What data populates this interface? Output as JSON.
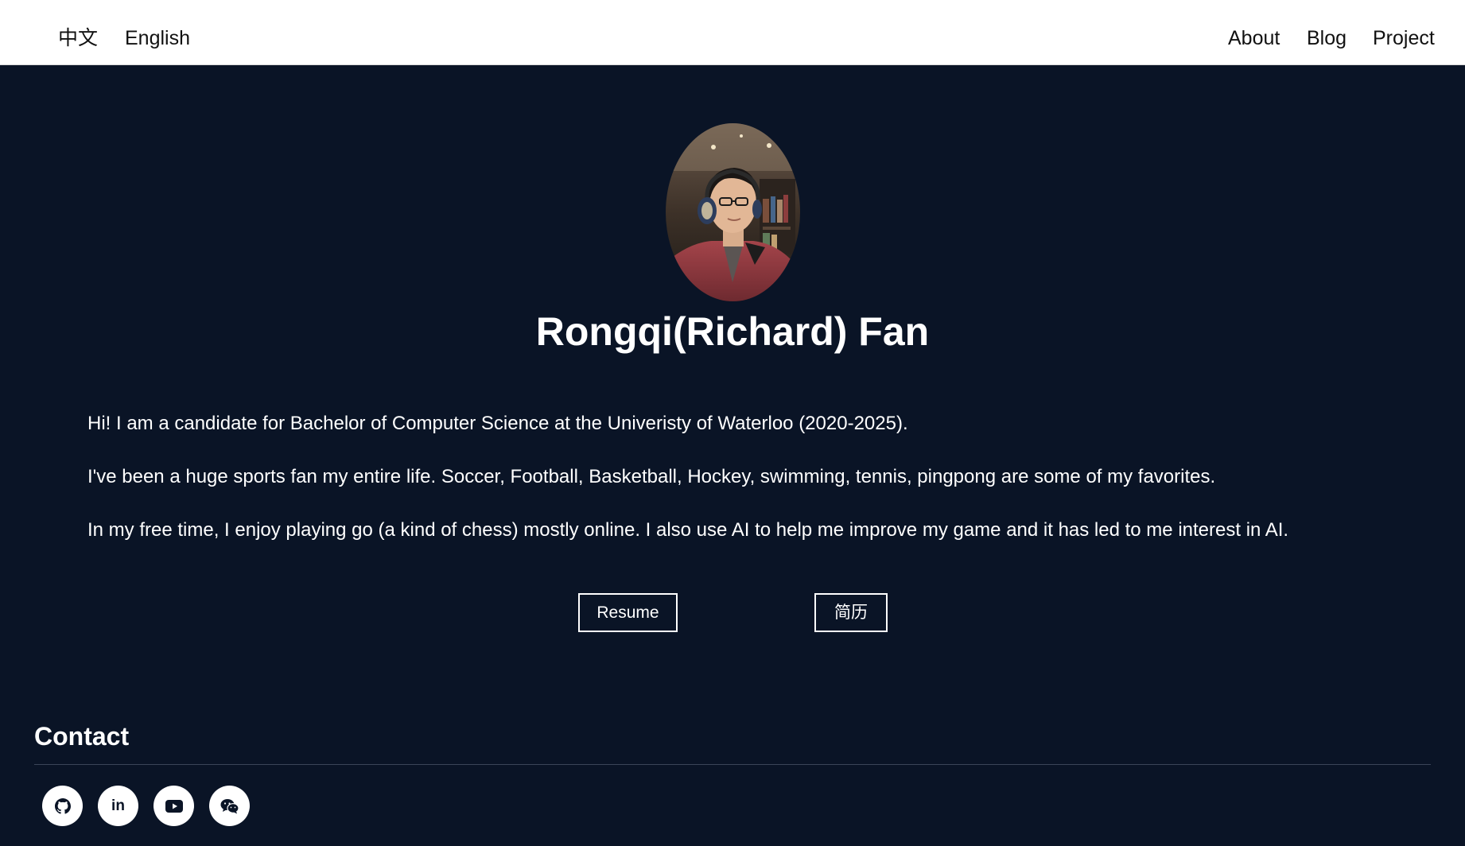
{
  "nav": {
    "lang_zh": "中文",
    "lang_en": "English",
    "about": "About",
    "blog": "Blog",
    "project": "Project"
  },
  "profile": {
    "name": "Rongqi(Richard) Fan"
  },
  "bio": [
    "Hi! I am a candidate for Bachelor of Computer Science at the Univeristy of Waterloo (2020-2025).",
    "I've been a huge sports fan my entire life. Soccer, Football, Basketball, Hockey, swimming, tennis, pingpong are some of my favorites.",
    "In my free time, I enjoy playing go (a kind of chess) mostly online. I also use AI to help me improve my game and it has led to me interest in AI."
  ],
  "buttons": {
    "resume": "Resume",
    "resume_zh": "简历"
  },
  "contact": {
    "title": "Contact",
    "icons": [
      "github-icon",
      "linkedin-icon",
      "youtube-icon",
      "wechat-icon"
    ]
  },
  "colors": {
    "background": "#0a1426",
    "navbar": "#ffffff",
    "text": "#ffffff"
  }
}
